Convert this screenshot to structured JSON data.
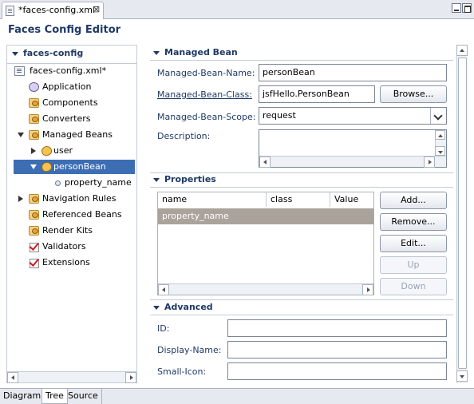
{
  "editor_tab": {
    "title": "*faces-config.xml",
    "close": "⊠"
  },
  "editor_title": "Faces Config Editor",
  "tree": {
    "header": "faces-config",
    "items": [
      {
        "label": "faces-config.xml*"
      },
      {
        "label": "Application"
      },
      {
        "label": "Components"
      },
      {
        "label": "Converters"
      },
      {
        "label": "Managed Beans"
      },
      {
        "label": "user"
      },
      {
        "label": "personBean"
      },
      {
        "label": "property_name"
      },
      {
        "label": "Navigation Rules"
      },
      {
        "label": "Referenced Beans"
      },
      {
        "label": "Render Kits"
      },
      {
        "label": "Validators"
      },
      {
        "label": "Extensions"
      }
    ],
    "selected": "personBean"
  },
  "managed_bean": {
    "header": "Managed Bean",
    "name_label": "Managed-Bean-Name:",
    "name_value": "personBean",
    "class_label": "Managed-Bean-Class:",
    "class_value": "jsfHello.PersonBean",
    "browse_label": "Browse...",
    "scope_label": "Managed-Bean-Scope:",
    "scope_value": "request",
    "description_label": "Description:",
    "description_value": ""
  },
  "properties": {
    "header": "Properties",
    "columns": [
      "name",
      "class",
      "Value"
    ],
    "rows": [
      {
        "name": "property_name",
        "class": "",
        "value": ""
      }
    ],
    "buttons": {
      "add": "Add...",
      "remove": "Remove...",
      "edit": "Edit...",
      "up": "Up",
      "down": "Down"
    }
  },
  "advanced": {
    "header": "Advanced",
    "id_label": "ID:",
    "id_value": "",
    "display_name_label": "Display-Name:",
    "display_name_value": "",
    "small_icon_label": "Small-Icon:",
    "small_icon_value": ""
  },
  "bottom_tabs": [
    "Diagram",
    "Tree",
    "Source"
  ],
  "active_bottom_tab": "Tree"
}
